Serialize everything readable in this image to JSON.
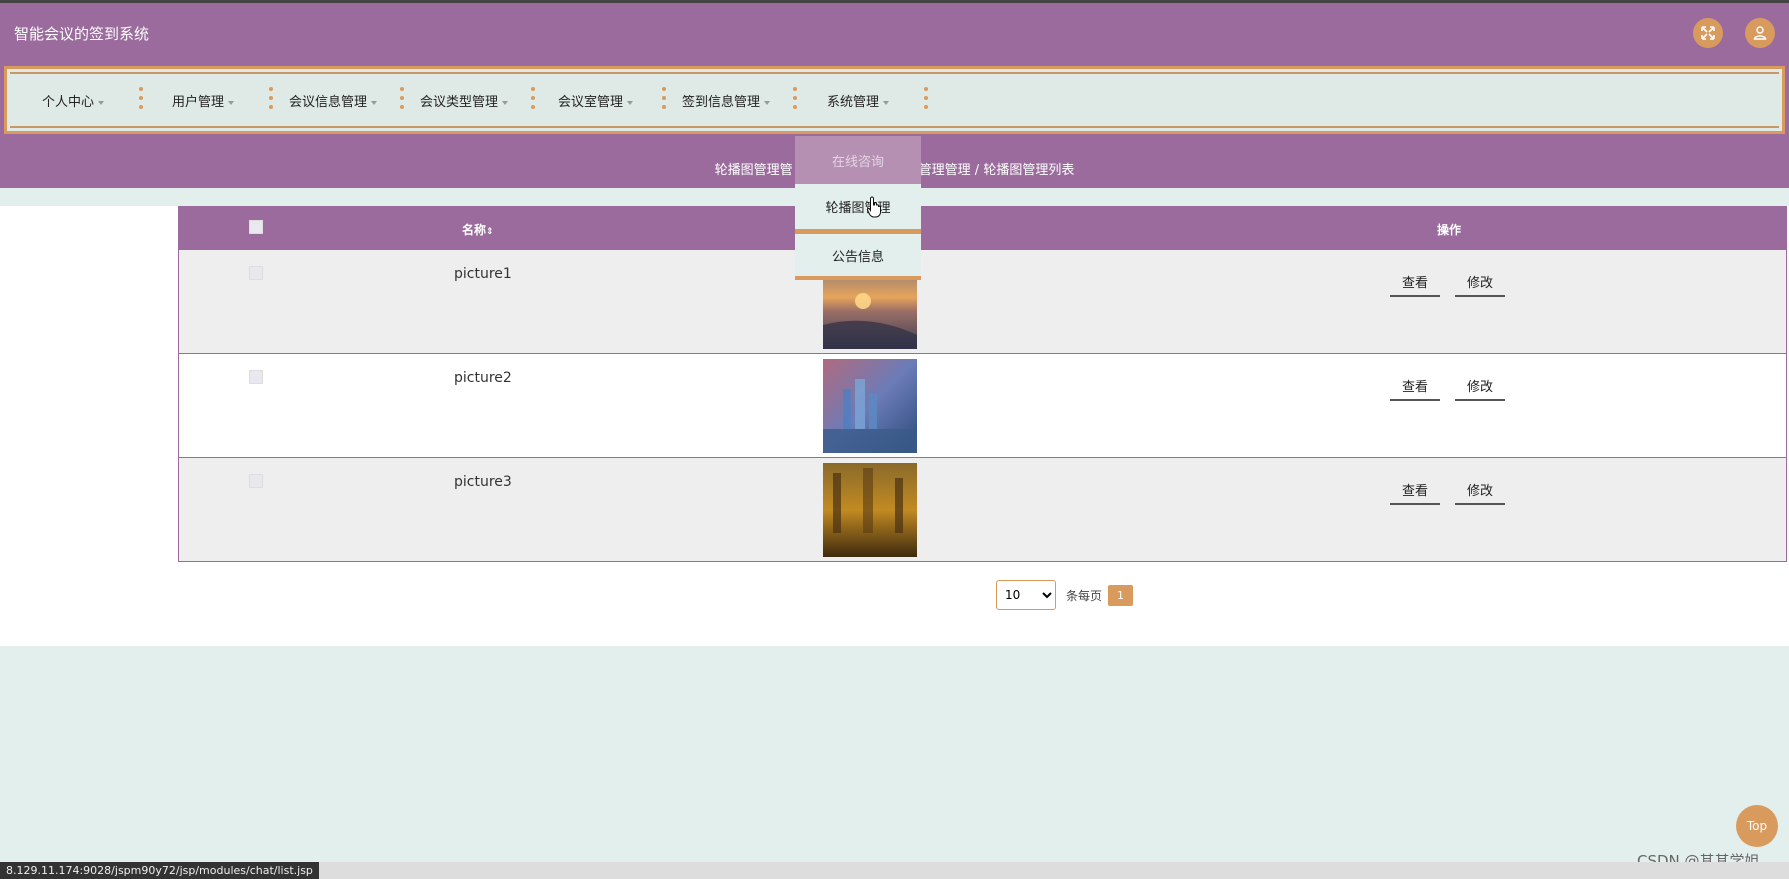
{
  "header": {
    "title": "智能会议的签到系统",
    "colors": {
      "primary": "#9a6b9c",
      "accent": "#d99a5e",
      "background": "#e3efec"
    }
  },
  "nav": {
    "items": [
      {
        "label": "个人中心"
      },
      {
        "label": "用户管理"
      },
      {
        "label": "会议信息管理"
      },
      {
        "label": "会议类型管理"
      },
      {
        "label": "会议室管理"
      },
      {
        "label": "签到信息管理"
      },
      {
        "label": "系统管理"
      }
    ]
  },
  "dropdown": {
    "header_label": "在线咨询",
    "items": [
      "轮播图管理",
      "公告信息"
    ]
  },
  "breadcrumb": {
    "left_text": "轮播图管理管",
    "right_text": "管理管理 / 轮播图管理列表"
  },
  "table": {
    "columns": {
      "name": "名称",
      "actions": "操作"
    },
    "rows": [
      {
        "name": "picture1",
        "view": "查看",
        "edit": "修改"
      },
      {
        "name": "picture2",
        "view": "查看",
        "edit": "修改"
      },
      {
        "name": "picture3",
        "view": "查看",
        "edit": "修改"
      }
    ]
  },
  "pagination": {
    "page_size": "10",
    "per_page_label": "条每页",
    "current_page": "1"
  },
  "top_button": "Top",
  "watermark": "CSDN @其其学姐",
  "status_url": "8.129.11.174:9028/jspm90y72/jsp/modules/chat/list.jsp"
}
